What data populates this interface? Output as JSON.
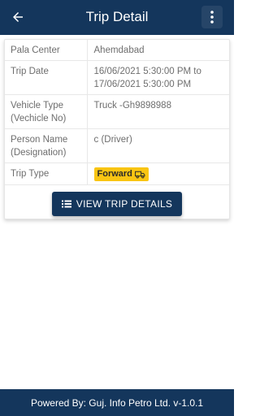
{
  "appbar": {
    "title": "Trip Detail"
  },
  "details": [
    {
      "label": "Pala Center",
      "value": "Ahemdabad"
    },
    {
      "label": "Trip Date",
      "value": "16/06/2021 5:30:00 PM to 17/06/2021 5:30:00 PM"
    },
    {
      "label": "Vehicle Type (Vechicle No)",
      "value": "Truck -Gh9898988"
    },
    {
      "label": "Person Name (Designation)",
      "value": "c (Driver)"
    },
    {
      "label": "Trip Type",
      "value": "Forward"
    }
  ],
  "actions": {
    "view_trip_details": "VIEW TRIP DETAILS"
  },
  "footer": {
    "text": "Powered By: Guj. Info Petro Ltd. v-1.0.1"
  },
  "colors": {
    "primary": "#14365c",
    "badge": "#f9c513"
  }
}
